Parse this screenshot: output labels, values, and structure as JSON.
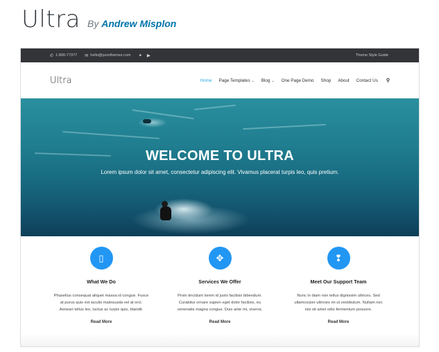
{
  "theme": {
    "name": "Ultra",
    "by": "By",
    "author": "Andrew Misplon"
  },
  "preview": {
    "topbar": {
      "phone_icon": "phone-icon",
      "phone": "1-800-77377",
      "email_icon": "envelope-icon",
      "email": "hello@purothemes.com",
      "social": [
        "twitter-icon",
        "youtube-icon"
      ],
      "style_guide": "Theme Style Guide"
    },
    "site_logo": "Ultra",
    "menu": [
      {
        "label": "Home",
        "active": true,
        "dropdown": false
      },
      {
        "label": "Page Templates",
        "active": false,
        "dropdown": true
      },
      {
        "label": "Blog",
        "active": false,
        "dropdown": true
      },
      {
        "label": "One Page Demo",
        "active": false,
        "dropdown": false
      },
      {
        "label": "Shop",
        "active": false,
        "dropdown": false
      },
      {
        "label": "About",
        "active": false,
        "dropdown": false
      },
      {
        "label": "Contact Us",
        "active": false,
        "dropdown": false
      }
    ],
    "search_icon": "search-icon",
    "hero": {
      "title": "WELCOME TO ULTRA",
      "subtitle": "Lorem ipsum dolor sit amet, consectetur adipiscing elit. Vivamus placerat turpis leo, quis pretium."
    },
    "features": [
      {
        "icon": "tablet-icon",
        "title": "What We Do",
        "lines": [
          "Phasellus consequat aliquet massa id congue. Fusce",
          "at purus quis est iaculis malesuada vel at orci.",
          "Aenean tellus leo, luctus ac turpis quis, blandit."
        ],
        "more": "Read More"
      },
      {
        "icon": "move-arrows-icon",
        "title": "Services We Offer",
        "lines": [
          "Proin tincidunt lorem id justo facilisis bibendum.",
          "Curabitur ornare sapien eget dolor facilisis, eu",
          "venenatis magna congue. Duis ante mi, viverra."
        ],
        "more": "Read More"
      },
      {
        "icon": "chat-bubbles-icon",
        "title": "Meet Our Support Team",
        "lines": [
          "Nunc in diam non tellus dignissim ultrices. Sed",
          "ullamcorper ultricies mi ut vestibulum. Nullam nec",
          "nisi sit amet odio fermentum posuere."
        ],
        "more": "Read More"
      }
    ],
    "colors": {
      "accent": "#2196f3",
      "active_menu": "#28a9e1",
      "topbar_bg": "#333438",
      "author_link": "#0073aa"
    }
  }
}
